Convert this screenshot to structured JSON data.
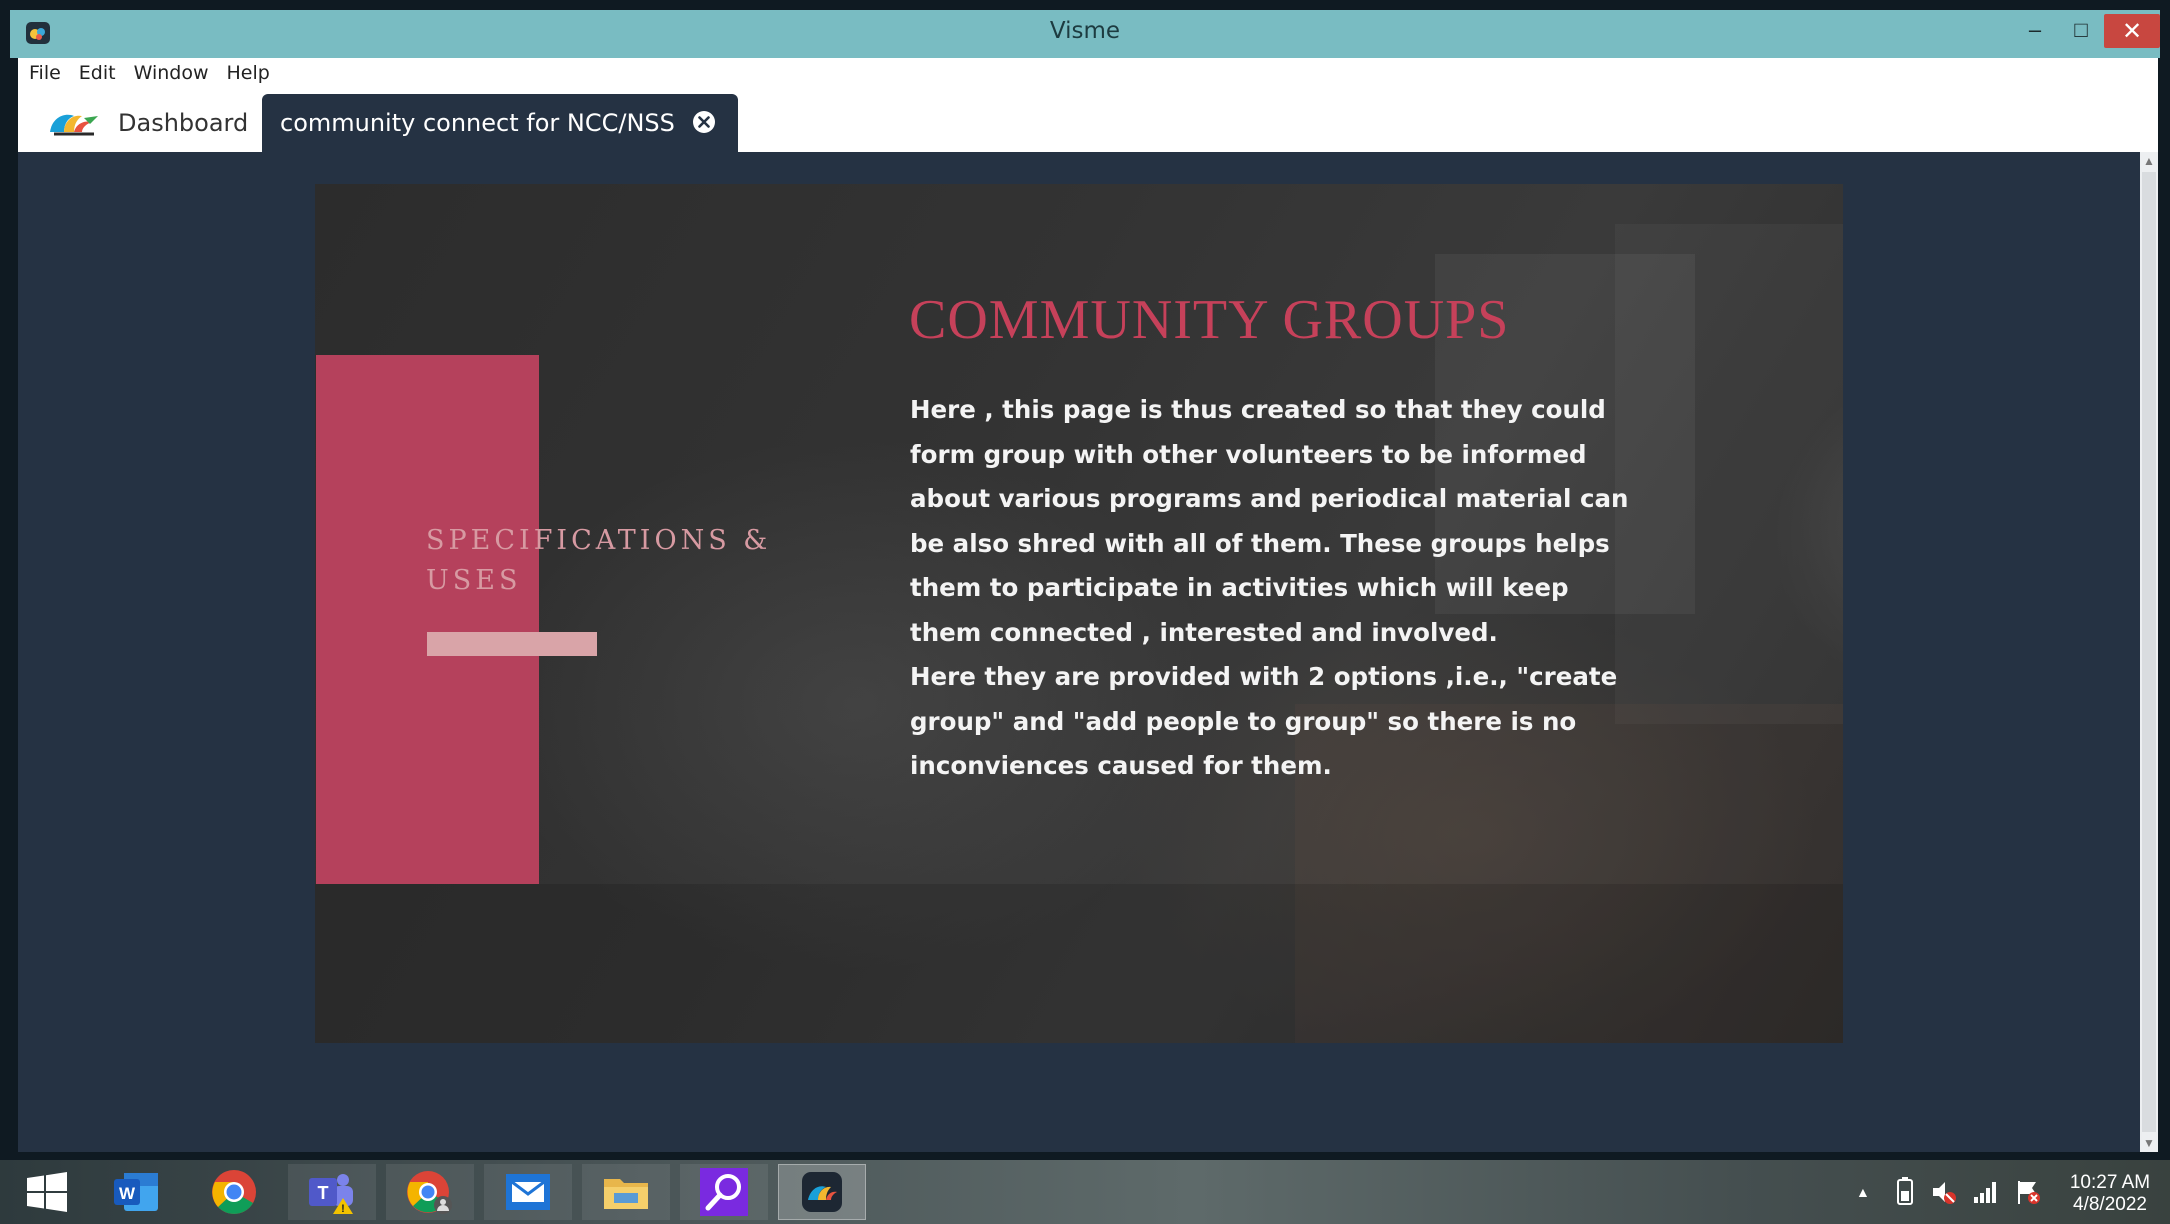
{
  "window": {
    "title": "Visme",
    "minimize_glyph": "–",
    "maximize_glyph": "□",
    "close_glyph": "✕"
  },
  "menu": {
    "items": [
      "File",
      "Edit",
      "Window",
      "Help"
    ]
  },
  "tabs": {
    "dashboard": "Dashboard",
    "project": "community connect for NCC/NSS"
  },
  "slide": {
    "side_heading": "SPECIFICATIONS & USES",
    "title": "COMMUNITY GROUPS",
    "paragraph_1": "Here , this page is thus created so that they could form group with other volunteers to be informed about various programs and periodical material can be also shred with all of them. These groups helps them to participate in activities which will keep them connected , interested and involved.",
    "paragraph_2": "Here they are provided with 2 options ,i.e., \"create group\" and \"add people to group\" so there is no inconviences caused for them."
  },
  "taskbar": {
    "apps": [
      "windows-start",
      "microsoft-word",
      "google-chrome",
      "microsoft-teams",
      "chrome-user",
      "mail",
      "file-explorer",
      "search",
      "visme"
    ],
    "clock_time": "10:27 AM",
    "clock_date": "4/8/2022"
  },
  "colors": {
    "titlebar": "#79bcc2",
    "workspace": "#253243",
    "accent_red": "#b5415c",
    "title_red": "#c6415a"
  }
}
